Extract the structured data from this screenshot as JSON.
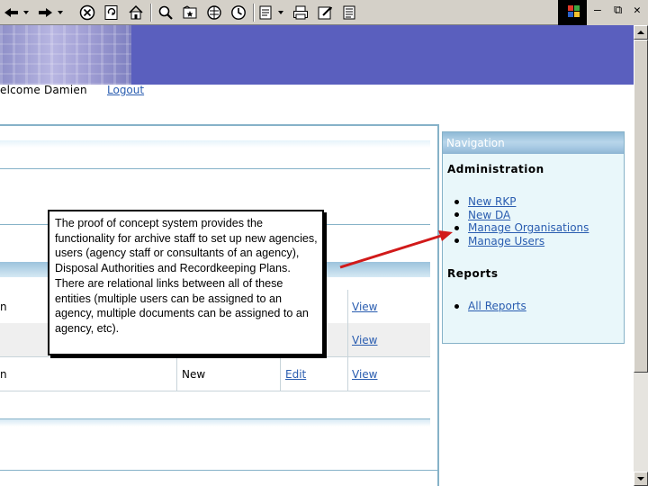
{
  "welcome": {
    "text": "elcome Damien",
    "logout_label": "Logout"
  },
  "table": {
    "rows": [
      {
        "name": "n",
        "status": "",
        "edit_label": "",
        "view_label": "View"
      },
      {
        "name": "",
        "status": "",
        "edit_label": "",
        "view_label": "View"
      },
      {
        "name": "n",
        "status": "New",
        "edit_label": "Edit",
        "view_label": "View"
      }
    ]
  },
  "navigation": {
    "title": "Navigation",
    "administration": {
      "heading": "Administration",
      "items": [
        "New RKP",
        "New DA",
        "Manage Organisations",
        "Manage Users"
      ]
    },
    "reports": {
      "heading": "Reports",
      "items": [
        "All Reports"
      ]
    }
  },
  "callout": {
    "text": "The proof of concept system provides the functionality for archive staff to set up new agencies, users (agency staff or consultants of an agency), Disposal Authorities and Recordkeeping Plans. There are relational links between all of these entities (multiple users can be assigned to an agency, multiple documents can be assigned to an agency, etc)."
  },
  "toolbar": {
    "icons": [
      "back-icon",
      "forward-icon",
      "stop-icon",
      "refresh-icon",
      "home-icon",
      "search-icon",
      "favorites-icon",
      "history-icon",
      "globe-icon",
      "edit-icon",
      "print-icon",
      "mail-icon",
      "notes-icon"
    ]
  },
  "colors": {
    "banner": "#5a5fbe",
    "panel_border": "#86b2c8",
    "link": "#2a5db0",
    "nav_bg": "#e9f7fa"
  }
}
